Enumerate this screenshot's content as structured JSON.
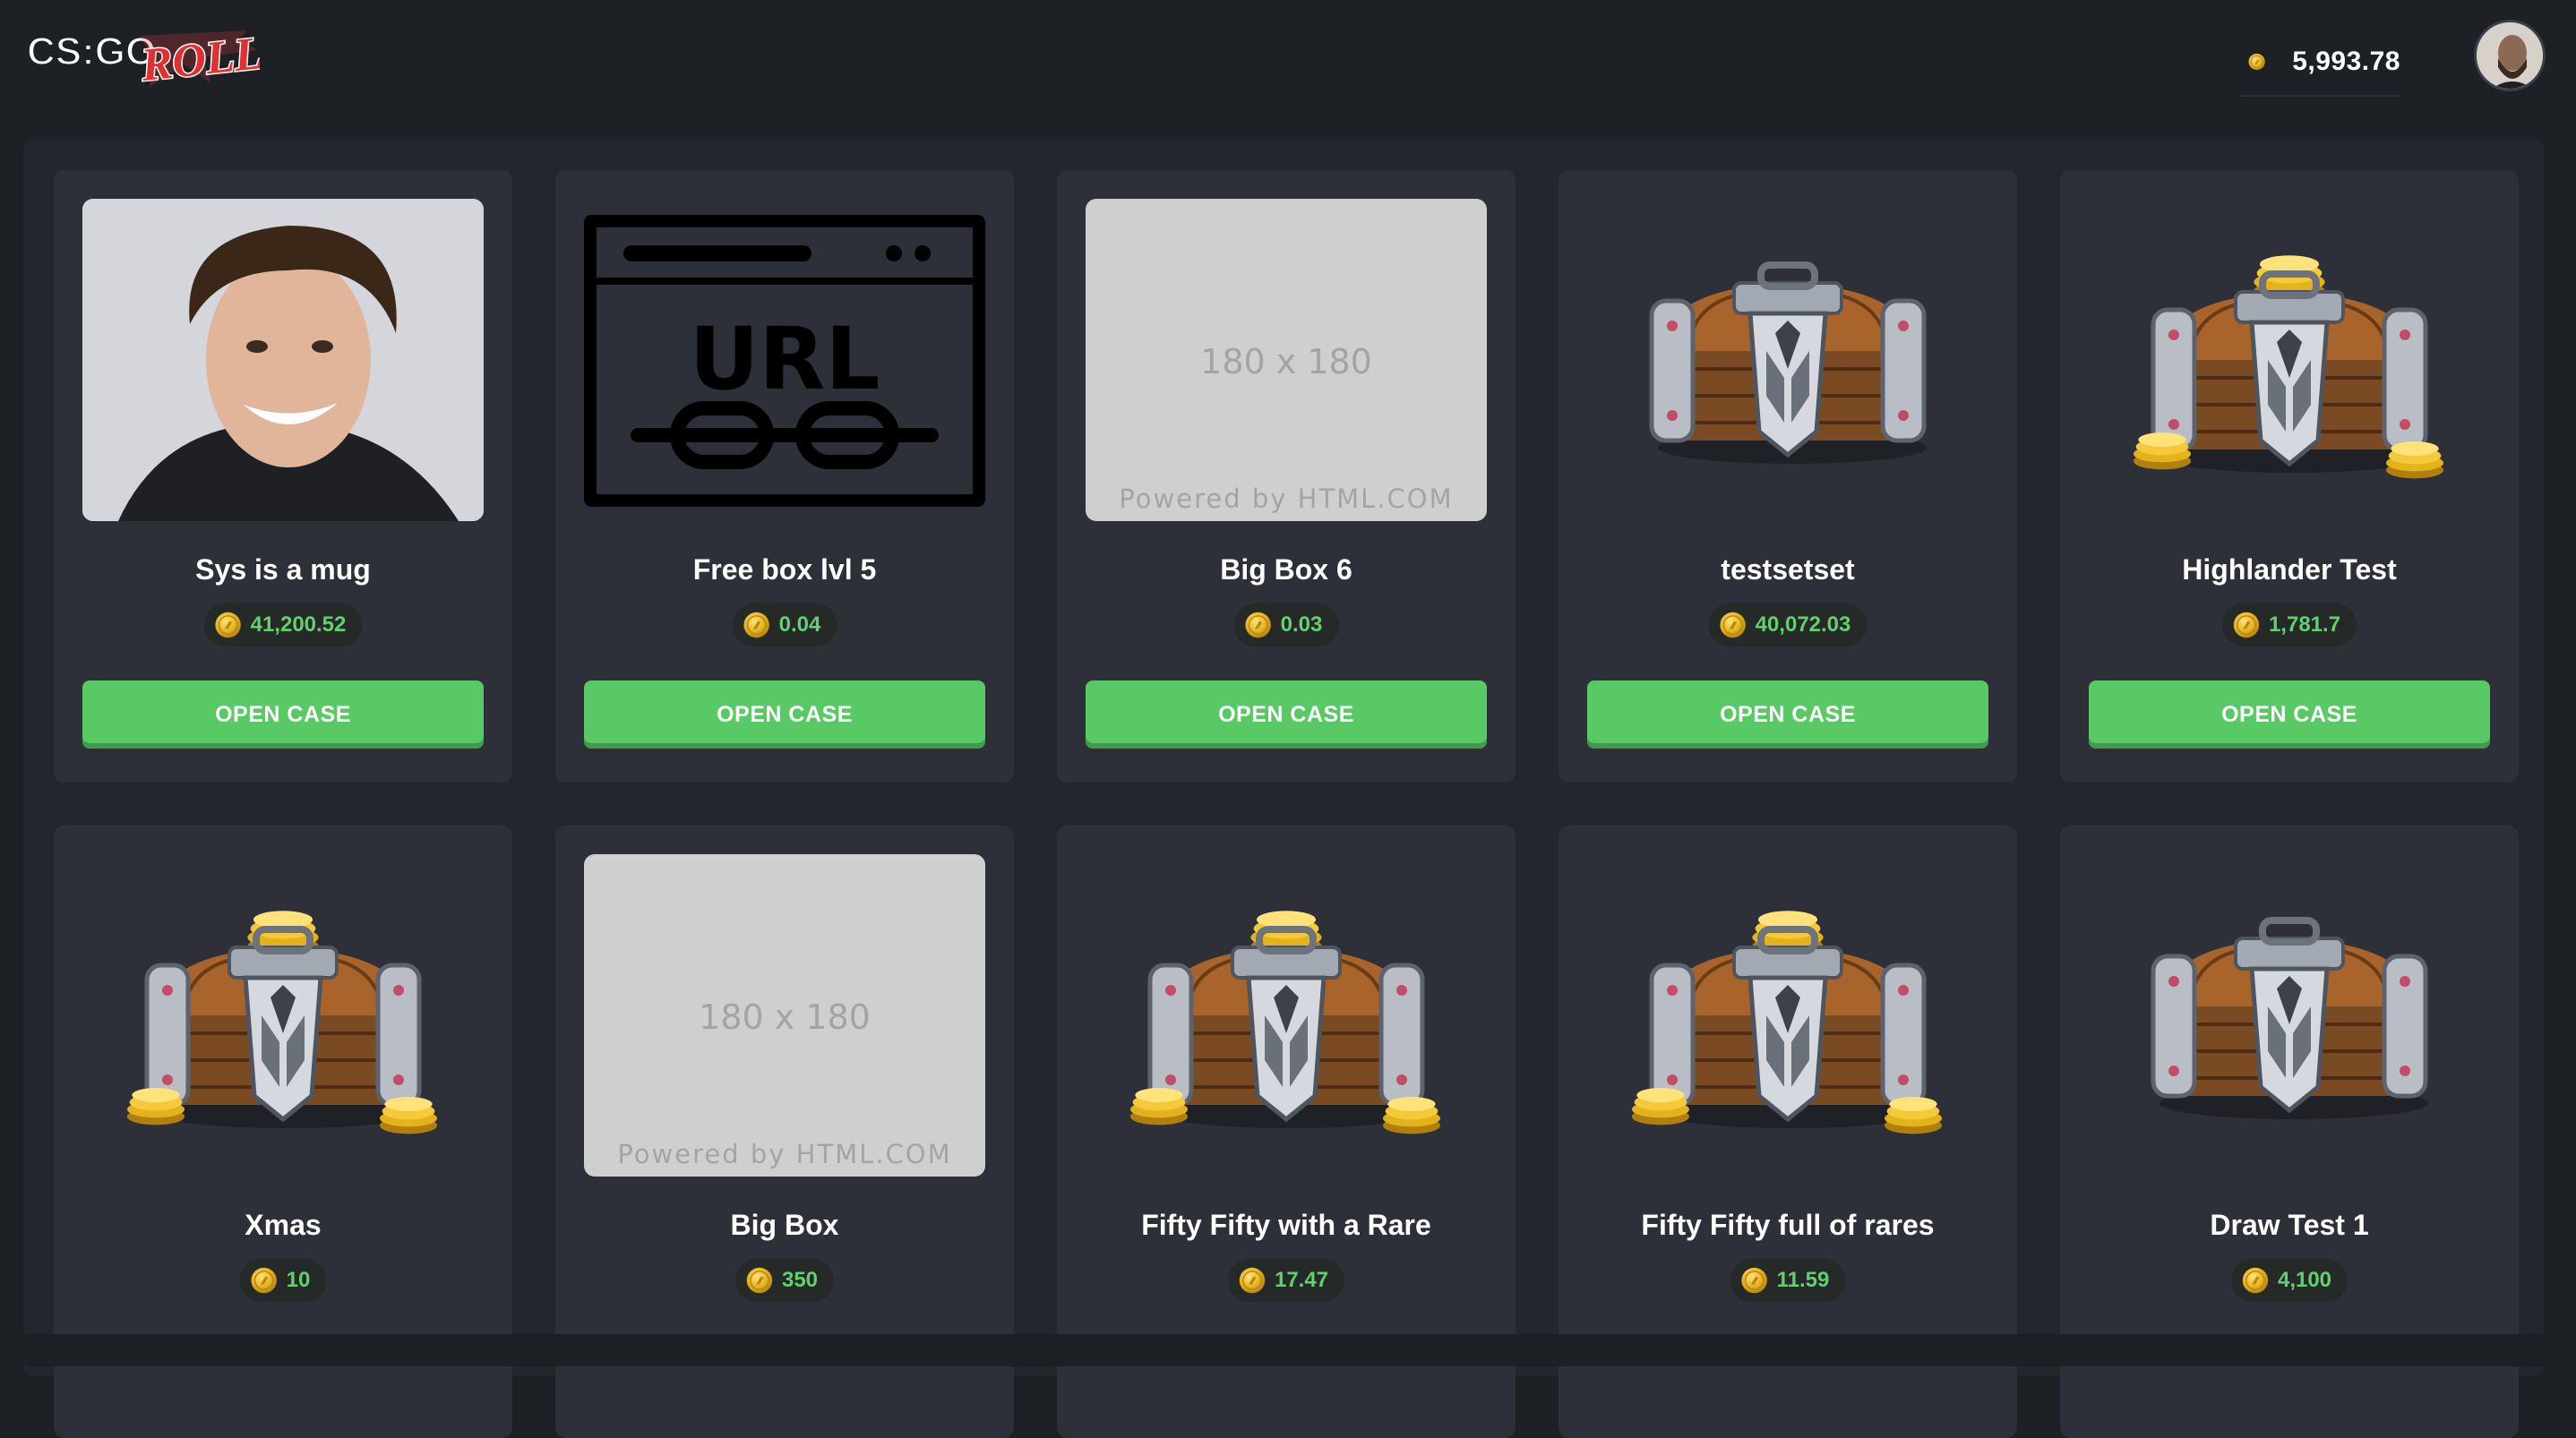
{
  "brand": {
    "logo_text_left": "CS:GO",
    "logo_text_right": "ROLL"
  },
  "header": {
    "balance": "5,993.78",
    "coin_icon": "coin-icon",
    "avatar_icon": "user-avatar"
  },
  "colors": {
    "background": "#1d2025",
    "card": "#2d3038",
    "button": "#58c964",
    "price_text": "#63d06f",
    "coin": "#e4b21c"
  },
  "open_case_label": "OPEN CASE",
  "placeholder": {
    "size": "180 x 180",
    "powered": "Powered by HTML.COM"
  },
  "url_icon": {
    "text": "URL"
  },
  "cases": [
    {
      "name": "Sys is a mug",
      "price": "41,200.52",
      "image": "person-photo"
    },
    {
      "name": "Free box lvl 5",
      "price": "0.04",
      "image": "url-link-icon"
    },
    {
      "name": "Big Box 6",
      "price": "0.03",
      "image": "placeholder-image"
    },
    {
      "name": "testsetset",
      "price": "40,072.03",
      "image": "treasure-chest"
    },
    {
      "name": "Highlander Test",
      "price": "1,781.7",
      "image": "treasure-chest-gold"
    },
    {
      "name": "Xmas",
      "price": "10",
      "image": "treasure-chest-gold"
    },
    {
      "name": "Big Box",
      "price": "350",
      "image": "placeholder-image"
    },
    {
      "name": "Fifty Fifty with a Rare",
      "price": "17.47",
      "image": "treasure-chest-gold"
    },
    {
      "name": "Fifty Fifty full of rares",
      "price": "11.59",
      "image": "treasure-chest-gold"
    },
    {
      "name": "Draw Test 1",
      "price": "4,100",
      "image": "treasure-chest"
    }
  ]
}
